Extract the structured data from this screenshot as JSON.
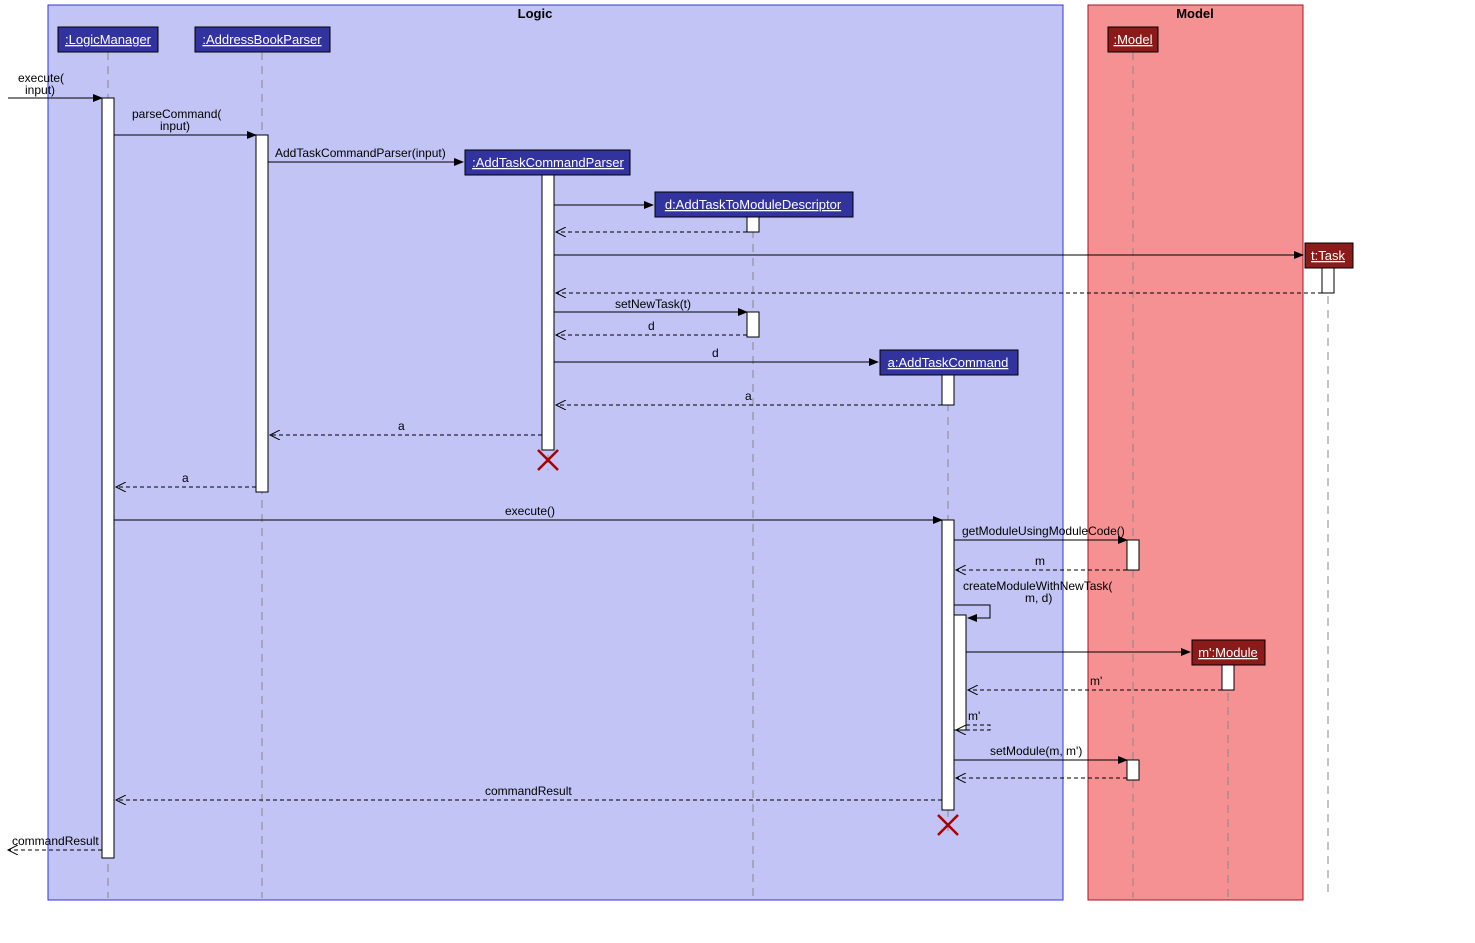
{
  "frames": {
    "logic": "Logic",
    "model": "Model"
  },
  "lifelines": {
    "logicManager": ":LogicManager",
    "addressBookParser": ":AddressBookParser",
    "addTaskCommandParser": ":AddTaskCommandParser",
    "descriptor": "d:AddTaskToModuleDescriptor",
    "addTaskCommand": "a:AddTaskCommand",
    "model": ":Model",
    "task": "t:Task",
    "module": "m':Module"
  },
  "messages": {
    "executeInput": "execute(\ninput)",
    "parseCommand": "parseCommand(\ninput)",
    "addTaskParserCreate": "AddTaskCommandParser(input)",
    "setNewTask": "setNewTask(t)",
    "returnD": "d",
    "returnD2": "d",
    "returnA": "a",
    "returnA2": "a",
    "returnA3": "a",
    "execute": "execute()",
    "getModule": "getModuleUsingModuleCode()",
    "returnM": "m",
    "createModule": "createModuleWithNewTask(\nm, d)",
    "returnMp": "m'",
    "returnMp2": "m'",
    "setModule": "setModule(m, m')",
    "commandResult": "commandResult",
    "commandResult2": "commandResult"
  }
}
